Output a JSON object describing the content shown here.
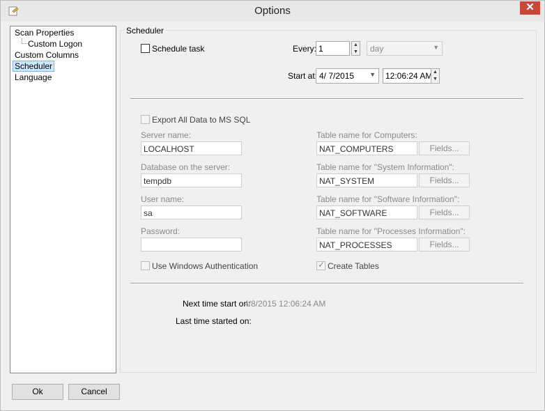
{
  "window": {
    "title": "Options",
    "close_glyph": "✕"
  },
  "tree": {
    "items": [
      {
        "label": "Scan Properties"
      },
      {
        "label": "Custom Logon"
      },
      {
        "label": "Custom Columns"
      },
      {
        "label": "Scheduler"
      },
      {
        "label": "Language"
      }
    ],
    "selected": "Scheduler"
  },
  "scheduler": {
    "group_title": "Scheduler",
    "schedule_task_label": "Schedule task",
    "every_label": "Every:",
    "every_value": "1",
    "unit_value": "day",
    "start_at_label": "Start at:",
    "start_date": "4/  7/2015",
    "start_time": "12:06:24 AM"
  },
  "export": {
    "export_label": "Export All Data to MS SQL",
    "server_label": "Server name:",
    "server_value": "LOCALHOST",
    "database_label": "Database on the server:",
    "database_value": "tempdb",
    "user_label": "User name:",
    "user_value": "sa",
    "password_label": "Password:",
    "password_value": "",
    "windows_auth_label": "Use Windows Authentication",
    "computers_label": "Table name for Computers:",
    "computers_value": "NAT_COMPUTERS",
    "sysinfo_label": "Table name for \"System Information\":",
    "sysinfo_value": "NAT_SYSTEM",
    "software_label": "Table name for \"Software Information\":",
    "software_value": "NAT_SOFTWARE",
    "processes_label": "Table name for \"Processes Information\":",
    "processes_value": "NAT_PROCESSES",
    "fields_label": "Fields...",
    "create_tables_label": "Create Tables",
    "create_tables_checked": true
  },
  "status": {
    "next_label": "Next time start on:",
    "next_value": "4/8/2015 12:06:24 AM",
    "last_label": "Last time started on:",
    "last_value": ""
  },
  "buttons": {
    "ok": "Ok",
    "cancel": "Cancel"
  },
  "icons": {
    "checkmark": "✓",
    "spin_up": "▲",
    "spin_down": "▼",
    "dropdown": "▼"
  },
  "colors": {
    "close": "#c7483b",
    "selection": "#cce8ff",
    "disabled_text": "#8a8a8a"
  }
}
